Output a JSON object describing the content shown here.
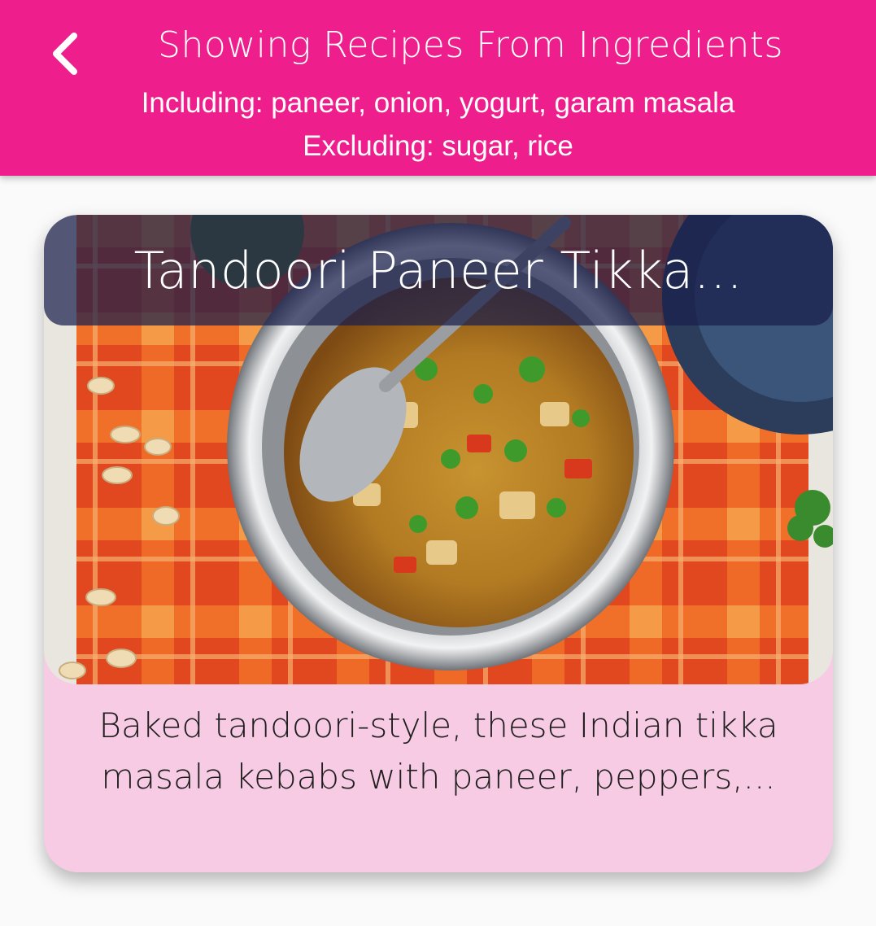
{
  "header": {
    "title": "Showing Recipes From Ingredients",
    "including": "Including: paneer, onion, yogurt, garam masala",
    "excluding": "Excluding: sugar, rice",
    "back_icon": "chevron-left-icon",
    "background_color": "#ee1f8c"
  },
  "recipe_card": {
    "title": "Tandoori Paneer Tikka...",
    "description": "Baked tandoori-style, these Indian tikka masala kebabs with paneer, peppers,...",
    "background_color": "#f7cbe3",
    "overlay_color": "#191e4b"
  }
}
